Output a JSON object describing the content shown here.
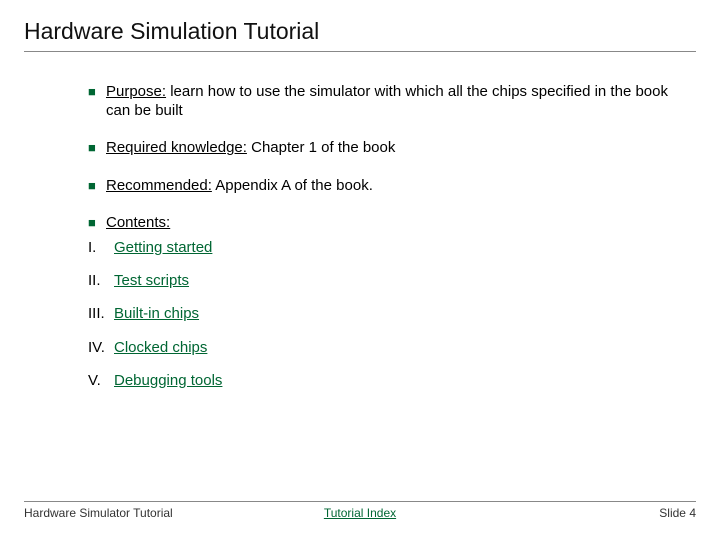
{
  "slide": {
    "title": "Hardware Simulation Tutorial",
    "bullets": [
      {
        "lead": "Purpose:",
        "rest": " learn how to use the simulator with which all the chips specified in the book can be built"
      },
      {
        "lead": "Required knowledge:",
        "rest": " Chapter 1 of the book"
      },
      {
        "lead": "Recommended:",
        "rest": " Appendix A of the book."
      },
      {
        "lead": "Contents:",
        "rest": ""
      }
    ],
    "contents": [
      {
        "num": "I.",
        "label": "Getting started"
      },
      {
        "num": "II.",
        "label": "Test scripts"
      },
      {
        "num": "III.",
        "label": "Built-in chips"
      },
      {
        "num": "IV.",
        "label": "Clocked chips"
      },
      {
        "num": "V.",
        "label": "Debugging tools"
      }
    ]
  },
  "footer": {
    "left": "Hardware Simulator Tutorial",
    "center": "Tutorial Index",
    "right": "Slide 4"
  }
}
